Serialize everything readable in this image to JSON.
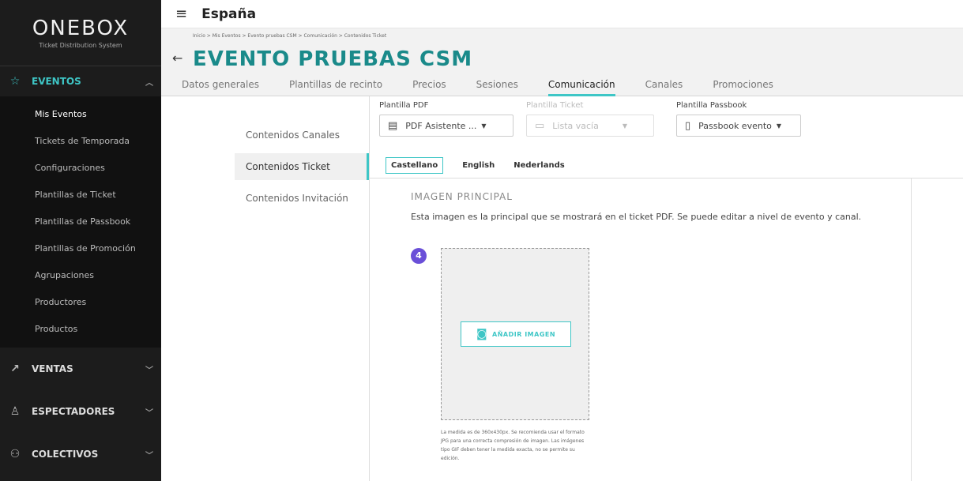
{
  "sidebar": {
    "logo": "ONEBOX",
    "logo_sub": "Ticket Distribution System",
    "sections": [
      {
        "label": "EVENTOS",
        "icon": "star-icon",
        "active": true
      },
      {
        "label": "VENTAS",
        "icon": "trend-icon"
      },
      {
        "label": "ESPECTADORES",
        "icon": "person-icon"
      },
      {
        "label": "COLECTIVOS",
        "icon": "group-icon"
      }
    ],
    "sub_items": [
      "Mis Eventos",
      "Tickets de Temporada",
      "Configuraciones",
      "Plantillas de Ticket",
      "Plantillas de Passbook",
      "Plantillas de Promoción",
      "Agrupaciones",
      "Productores",
      "Productos"
    ]
  },
  "topbar": {
    "country": "España"
  },
  "header": {
    "breadcrumb": "Inicio > Mis Eventos > Evento pruebas CSM > Comunicación > Contenidos Ticket",
    "title": "EVENTO PRUEBAS CSM",
    "tabs": [
      "Datos generales",
      "Plantillas de recinto",
      "Precios",
      "Sesiones",
      "Comunicación",
      "Canales",
      "Promociones"
    ]
  },
  "content_nav": [
    "Contenidos Canales",
    "Contenidos Ticket",
    "Contenidos Invitación"
  ],
  "templates": {
    "pdf": {
      "label": "Plantilla PDF",
      "value": "PDF Asistente ..."
    },
    "ticket": {
      "label": "Plantilla Ticket",
      "value": "Lista vacía"
    },
    "passbook": {
      "label": "Plantilla Passbook",
      "value": "Passbook evento"
    }
  },
  "languages": [
    "Castellano",
    "English",
    "Nederlands"
  ],
  "image_section": {
    "title": "IMAGEN PRINCIPAL",
    "description": "Esta imagen es la principal que se mostrará en el ticket PDF. Se puede editar a nivel de evento y canal.",
    "step": "4",
    "add_button": "AÑADIR IMAGEN",
    "hint": "La medida es de 360x430px. Se recomienda usar el formato JPG para una correcta compresión de imagen. Las imágenes tipo GIF deben tener la medida exacta, no se permite su edición."
  },
  "colors": {
    "accent": "#3ec6c6",
    "title": "#1a8a8a",
    "badge": "#6a4fd8",
    "sidebar": "#1c1c1c"
  }
}
